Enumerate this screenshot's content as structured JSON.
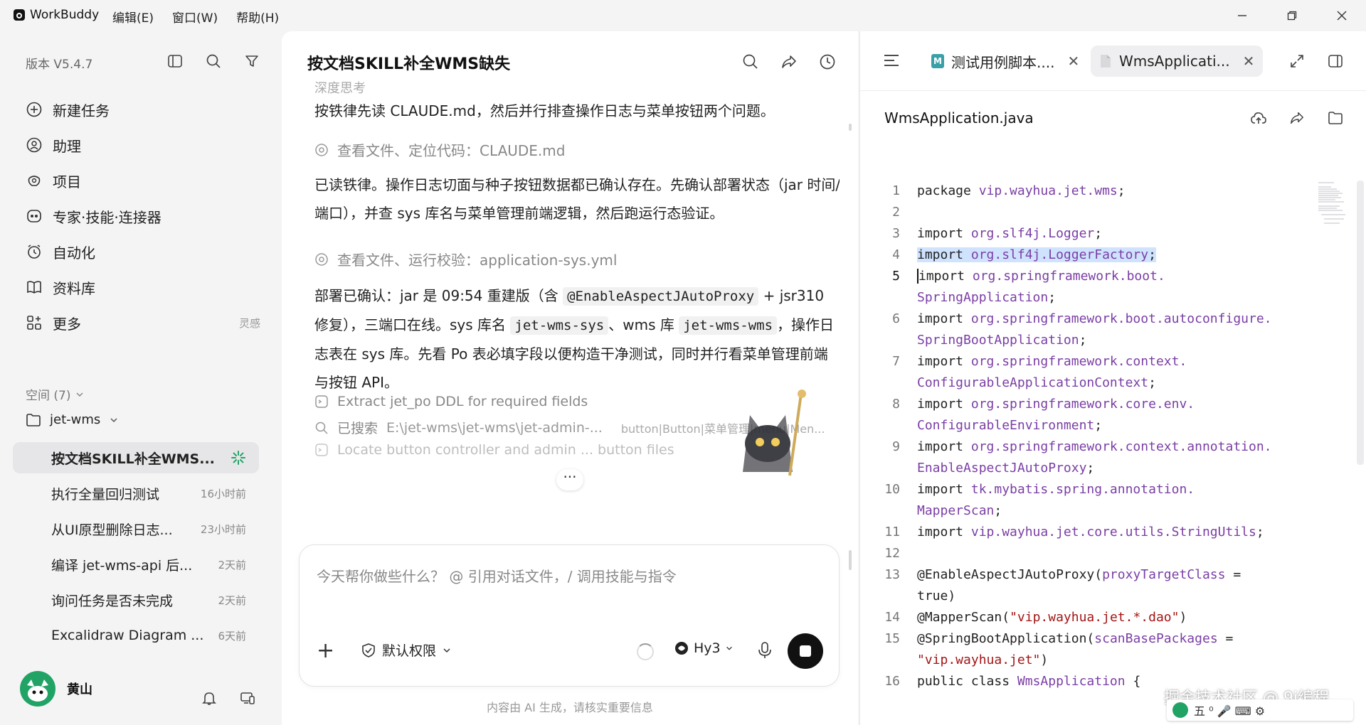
{
  "app": {
    "name": "WorkBuddy",
    "menu": [
      "编辑(E)",
      "窗口(W)",
      "帮助(H)"
    ]
  },
  "sidebar": {
    "version": "版本 V5.4.7",
    "nav": [
      {
        "label": "新建任务",
        "icon": "plus-circle-icon"
      },
      {
        "label": "助理",
        "icon": "assistant-icon"
      },
      {
        "label": "项目",
        "icon": "project-icon"
      },
      {
        "label": "专家·技能·连接器",
        "icon": "expert-icon"
      },
      {
        "label": "自动化",
        "icon": "alarm-icon"
      },
      {
        "label": "资料库",
        "icon": "book-icon"
      },
      {
        "label": "更多",
        "icon": "apps-icon",
        "hint": "灵感"
      }
    ],
    "space_label": "空间 (7)",
    "folder": "jet-wms",
    "tasks": [
      {
        "title": "按文档SKILL补全WMS...",
        "time": ""
      },
      {
        "title": "执行全量回归测试",
        "time": "16小时前"
      },
      {
        "title": "从UI原型删除日志...",
        "time": "23小时前"
      },
      {
        "title": "编译 jet-wms-api 后...",
        "time": "2天前"
      },
      {
        "title": "询问任务是否未完成",
        "time": "2天前"
      },
      {
        "title": "Excalidraw Diagram ...",
        "time": "6天前"
      }
    ],
    "user": "黄山"
  },
  "chat": {
    "title": "按文档SKILL补全WMS缺失",
    "faded_top": "深度思考",
    "p1": "按铁律先读 CLAUDE.md，然后并行排查操作日志与菜单按钮两个问题。",
    "tool1": {
      "label": "查看文件、定位代码：",
      "file": "CLAUDE.md"
    },
    "p2": "已读铁律。操作日志切面与种子按钮数据都已确认存在。先确认部署状态（jar 时间/端口），并查 sys 库名与菜单管理前端逻辑，然后跑运行态验证。",
    "tool2": {
      "label": "查看文件、运行校验：",
      "file": "application-sys.yml"
    },
    "p3": {
      "a": "部署已确认：jar 是 09:54 重建版（含 ",
      "c1": "@EnableAspectJAutoProxy",
      "b": " + jsr310 修复），三端口在线。sys 库名 ",
      "c2": "jet-wms-sys",
      "c": "、wms 库 ",
      "c3": "jet-wms-wms",
      "d": "，操作日志表在 sys 库。先看 Po 表必填字段以便构造干净测试，同时并行看菜单管理前端与按钮 API。"
    },
    "step1": "Extract jet_po DDL for required fields",
    "step2": {
      "label": "已搜索",
      "path": "E:\\jet-wms\\jet-wms\\jet-admin-...",
      "query": "button|Button|菜单管理|menu|Men..."
    },
    "step3": "Locate button controller and admin ... button files",
    "more": "···",
    "composer_placeholder": "今天帮你做些什么？ @ 引用对话文件，/ 调用技能与指令",
    "permission": "默认权限",
    "model": "Hy3",
    "disclaimer": "内容由 AI 生成，请核实重要信息"
  },
  "editor": {
    "tabs": [
      {
        "label": "测试用例脚本....",
        "icon": "M"
      },
      {
        "label": "WmsApplicati...",
        "icon": "file"
      }
    ],
    "file_title": "WmsApplication.java",
    "lines": [
      {
        "n": "1"
      },
      {
        "n": "2"
      },
      {
        "n": "3"
      },
      {
        "n": "4"
      },
      {
        "n": "5"
      },
      {
        "n": "6"
      },
      {
        "n": "7"
      },
      {
        "n": "8"
      },
      {
        "n": "9"
      },
      {
        "n": "10"
      },
      {
        "n": "11"
      },
      {
        "n": "12"
      },
      {
        "n": "13"
      },
      {
        "n": "14"
      },
      {
        "n": "15"
      },
      {
        "n": "16"
      }
    ],
    "code": {
      "l1a": "package ",
      "l1b": "vip.wayhua.jet.wms",
      "l1c": ";",
      "imp": "import ",
      "l3b": "org.slf4j.Logger",
      "semi": ";",
      "l4b": "org.slf4j.LoggerFactory",
      "l5b": "org.springframework.boot.",
      "l5c": "SpringApplication",
      "l6b": "org.springframework.boot.autoconfigure.",
      "l6c": "SpringBootApplication",
      "l7b": "org.springframework.context.",
      "l7c": "ConfigurableApplicationContext",
      "l8b": "org.springframework.core.env.",
      "l8c": "ConfigurableEnvironment",
      "l9b": "org.springframework.context.annotation.",
      "l9c": "EnableAspectJAutoProxy",
      "l10b": "tk.mybatis.spring.annotation.",
      "l10c": "MapperScan",
      "l11b": "vip.wayhua.jet.core.utils.StringUtils",
      "l13a": "@EnableAspectJAutoProxy",
      "l13b": "(",
      "l13c": "proxyTargetClass",
      "l13d": " =",
      "l13e": "true)",
      "l14a": "@MapperScan",
      "l14b": "(",
      "l14c": "\"vip.wayhua.jet.*.dao\"",
      "l14d": ")",
      "l15a": "@SpringBootApplication",
      "l15b": "(",
      "l15c": "scanBasePackages",
      "l15d": " =",
      "l15e": "\"vip.wayhua.jet\"",
      "l15f": ")",
      "l16a": "public class ",
      "l16b": "WmsApplication",
      "l16c": " {"
    }
  },
  "overlay": {
    "watermark": "掘金技术社区 @ 9i编程",
    "ime": "五 ⁰ 🎤 ⌨ ⚙"
  },
  "colors": {
    "accent": "#21a366",
    "package": "#7a3ea5",
    "string": "#a31515",
    "highlight": "#cfe3ff"
  }
}
